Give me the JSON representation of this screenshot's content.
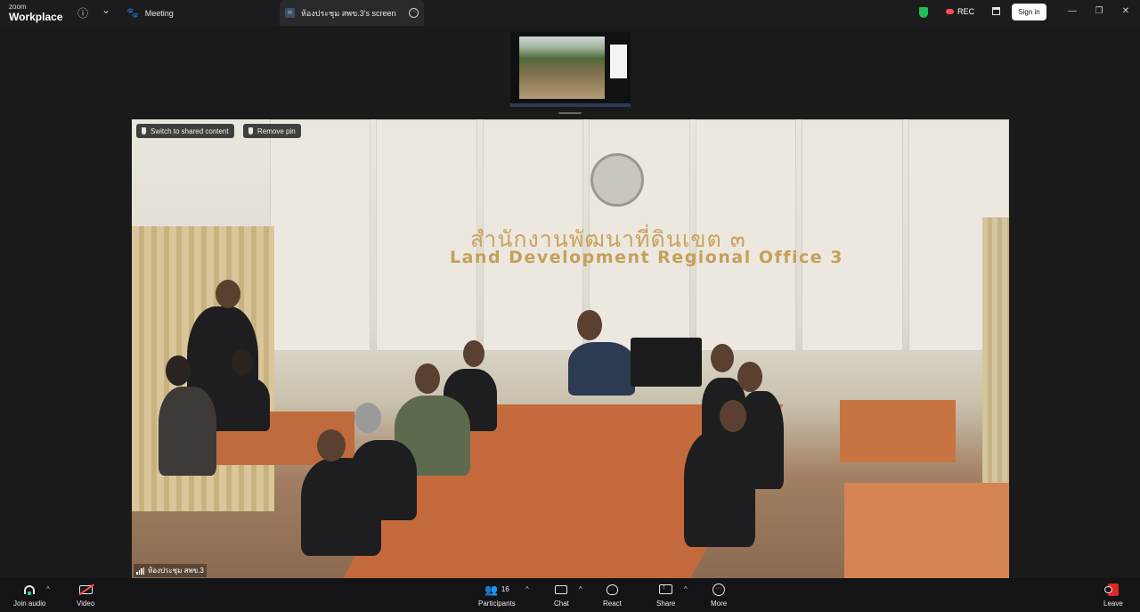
{
  "app": {
    "logo_small": "zoom",
    "logo_big": "Workplace"
  },
  "tabs": {
    "meeting_label": "Meeting",
    "screen_badge": "H",
    "screen_label": "ห้องประชุม สพข.3's screen"
  },
  "titlebar": {
    "rec_label": "REC",
    "signin_label": "Sign in",
    "minimize": "—",
    "restore": "❐",
    "close": "✕",
    "info": "ⓘ",
    "chevron": "⌄",
    "more": "···"
  },
  "video": {
    "switch_label": "Switch to shared content",
    "remove_pin_label": "Remove pin",
    "participant_name": "ห้องประชุม สพข.3",
    "sign_thai": "สำนักงานพัฒนาที่ดินเขต ๓",
    "sign_english": "Land Development Regional Office 3"
  },
  "toolbar": {
    "join_audio": "Join audio",
    "video": "Video",
    "participants_count": "16",
    "participants": "Participants",
    "chat": "Chat",
    "react": "React",
    "share": "Share",
    "more": "More",
    "leave": "Leave",
    "caret": "^"
  },
  "colors": {
    "shield": "#1ec05a",
    "rec_dot": "#ff4e4e",
    "leave": "#e02828",
    "audio_accent": "#2fd08d"
  }
}
